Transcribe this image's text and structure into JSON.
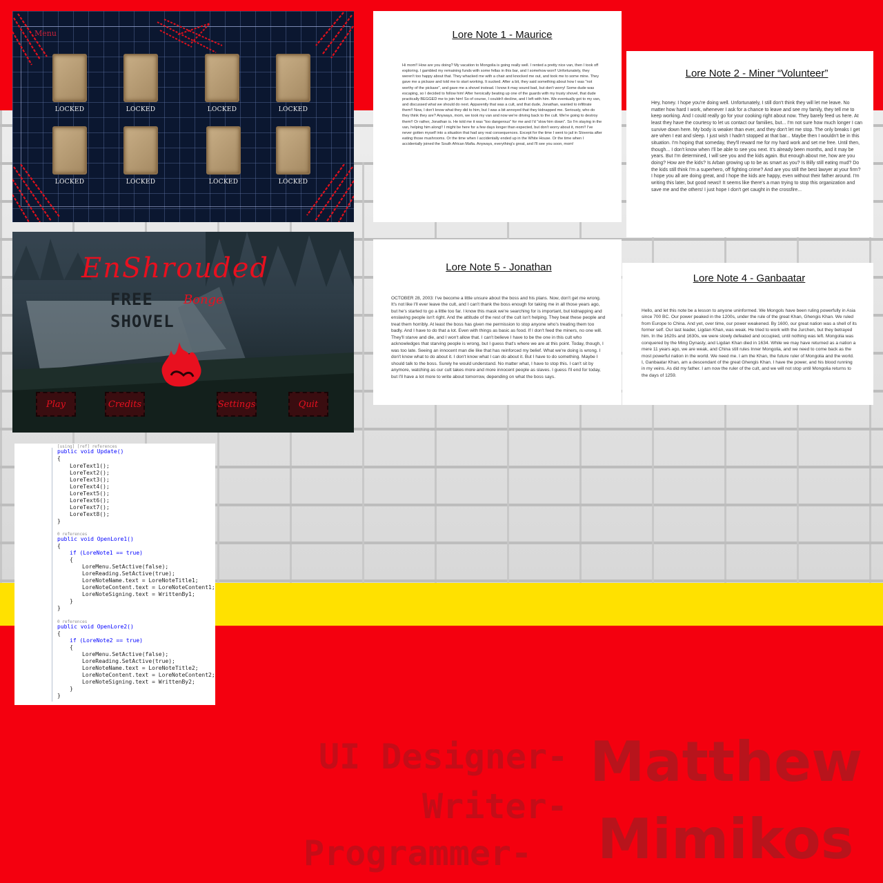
{
  "lore_menu": {
    "title": "Menu",
    "slots": [
      {
        "label": "LOCKED"
      },
      {
        "label": "LOCKED"
      },
      {
        "label": "LOCKED"
      },
      {
        "label": "LOCKED"
      },
      {
        "label": "LOCKED"
      },
      {
        "label": "LOCKED"
      },
      {
        "label": "LOCKED"
      },
      {
        "label": "LOCKED"
      }
    ]
  },
  "notes": {
    "note1": {
      "title": "Lore Note 1 - Maurice",
      "body": "Hi mom!! How are you doing? My vacation to Mongolia is going really well. I rented a pretty nice van, then I took off exploring. I gambled my remaining funds with some fellas in this bar, and I somehow won!! Unfortunately, they weren't too happy about that. They whacked me with a chair and knocked me out, and took me to some mine. They gave me a pickaxe and told me to start working. It sucked. After a bit, they said something about how I was \"not worthy of the pickaxe\", and gave me a shovel instead. I know it may sound bad, but don't worry! Some dude was escaping, so I decided to follow him! After heroically beating up one of the guards with my trusty shovel, that dude practically BEGGED me to join him! So of course, I couldn't decline, and I left with him. We eventually got to my van, and discussed what we should do next. Apparently that was a cult, and that dude, Jonathan, wanted to infiltrate them!! Now, I don't know what they did to him, but I was a bit annoyed that they kidnapped me. Seriously, who do they think they are? Anyways, mom, we took my van and now we're driving back to the cult. We're going to destroy them!! Or rather, Jonathan is. He told me it was \"too dangerous\" for me and I'd \"slow him down\". So I'm staying in the van, helping him along!! I might be here for a few days longer than expected, but don't worry about it, mom!! I've never gotten myself into a situation that had any real consequences. Except for the time I went to jail in Slovenia after eating those mushrooms. Or the time when I accidentally ended up in the White House. Or the time when I accidentally joined the South African Mafia. Anyways, everything's great, and I'll see you soon, mom!"
    },
    "note2": {
      "title": "Lore Note 2 - Miner “Volunteer”",
      "body": "Hey, honey. I hope you're doing well. Unfortunately, I still don't think they will let me leave. No matter how hard I work, whenever I ask for a chance to leave and see my family, they tell me to keep working. And I could really go for your cooking right about now. They barely feed us here. At least they have the courtesy to let us contact our families, but... I'm not sure how much longer I can survive down here. My body is weaker than ever, and they don't let me stop. The only breaks I get are when I eat and sleep. I just wish I hadn't stopped at that bar... Maybe then I wouldn't be in this situation. I'm hoping that someday, they'll reward me for my hard work and set me free. Until then, though... I don't know when I'll be able to see you next. It's already been months, and it may be years. But I'm determined, I will see you and the kids again. But enough about me, how are you doing? How are the kids? Is Arban growing up to be as smart as you? Is Billy still eating mud? Do the kids still think I'm a superhero, off fighting crime? And are you still the best lawyer at your firm? I hope you all are doing great, and I hope the kids are happy, even without their father around.                                              I'm writing this later, but good news!! It seems like there's a man trying to stop this organization and save me and the others! I just hope I don't get caught in the crossfire..."
    },
    "note5": {
      "title": "Lore Note 5 - Jonathan",
      "body": "OCTOBER 28, 2003: I've become a little unsure about the boss and his plans. Now, don't get me wrong. It's not like I'll ever leave the cult, and I can't thank the boss enough for taking me in all those years ago, but he's started to go a little too far. I know this mask we're searching for is important, but kidnapping and enslaving people isn't right. And the attitude of the rest of the cult isn't helping. They beat these people and treat them horribly. At least the boss has given me permission to stop anyone who's treating them too badly. And I have to do that a lot. Even with things as basic as food. If I don't feed the miners, no one will. They'll starve and die, and I won't allow that. I can't believe I have to be the one in this cult who acknowledges that starving people is wrong, but I guess that's where we are at this point. Today, though, I was too late. Seeing an innocent man die like that has reinforced my belief. What we're doing is wrong. I don't know what to do about it. I don't know what I can do about it. But I have to do something. Maybe I should talk to the boss. Surely he would understand. No matter what, I have to stop this. I can't sit by anymore, watching as our cult takes more and more innocent people as slaves. I guess I'll end for today, but I'll have a lot more to write about tomorrow, depending on what the boss says."
    },
    "note4": {
      "title": "Lore Note 4 - Ganbaatar",
      "body": "Hello, and let this note be a lesson to anyone uninformed. We Mongols have been ruling powerfully in Asia since 700 BC. Our power peaked in the 1200s, under the rule of the great Khan, Ghengis Khan. We ruled from Europe to China. And yet, over time, our power weakened. By 1600, our great nation was a shell of its former self. Our last leader, Ligdan Khan, was weak. He tried to work with the Jurchen, but they betrayed him. In the 1620s and 1630s, we were slowly defeated and occupied, until nothing was left. Mongolia was conquered by the Ming Dynasty, and Ligdan Khan died in 1634. While we may have returned as a nation a mere 11 years ago, we are weak, and China still rules Inner Mongolia, and we need to come back as the most powerful nation in the world. We need me. I am the Khan, the future ruler of Mongolia and the world. I, Ganbaatar Khan, am a descendant of the great Ghengis Khan. I have the power, and his blood running in my veins. As did my father. I am now the ruler of the cult, and we will not stop until Mongolia returns to the days of 1259."
    }
  },
  "title_screen": {
    "logo": "EnShrouded",
    "sub_line1": "FREE",
    "sub_line1_red": "Bonge",
    "sub_line2": "SHOVEL",
    "buttons": {
      "play": "Play",
      "credits": "Credits",
      "settings": "Settings",
      "quit": "Quit"
    }
  },
  "code": {
    "header": "[using] [ref] references",
    "update_sig": "public void Update()",
    "lore_calls": [
      "LoreText1();",
      "LoreText2();",
      "LoreText3();",
      "LoreText4();",
      "LoreText5();",
      "LoreText6();",
      "LoreText7();",
      "LoreText8();"
    ],
    "ref1": "0 references",
    "open1_sig": "public void OpenLore1()",
    "open1_if": "if (LoreNote1 == true)",
    "open1_body": [
      "LoreMenu.SetActive(false);",
      "LoreReading.SetActive(true);",
      "LoreNoteName.text = LoreNoteTitle1;",
      "LoreNoteContent.text = LoreNoteContent1;",
      "LoreNoteSigning.text = WrittenBy1;"
    ],
    "ref2": "0 references",
    "open2_sig": "public void OpenLore2()",
    "open2_if": "if (LoreNote2 == true)",
    "open2_body": [
      "LoreMenu.SetActive(false);",
      "LoreReading.SetActive(true);",
      "LoreNoteName.text = LoreNoteTitle2;",
      "LoreNoteContent.text = LoreNoteContent2;",
      "LoreNoteSigning.text = WrittenBy2;"
    ],
    "brace_open": "{",
    "brace_close": "}"
  },
  "credits": {
    "role1": "UI Designer-",
    "role2": "Writer-",
    "role3": "Programmer-",
    "first_name": "Matthew",
    "last_name": "Mimikos"
  },
  "colors": {
    "red_band": "#f4000f",
    "yellow_band": "#ffe100",
    "credit_text": "#c40d18",
    "ui_red": "#e8101f"
  }
}
